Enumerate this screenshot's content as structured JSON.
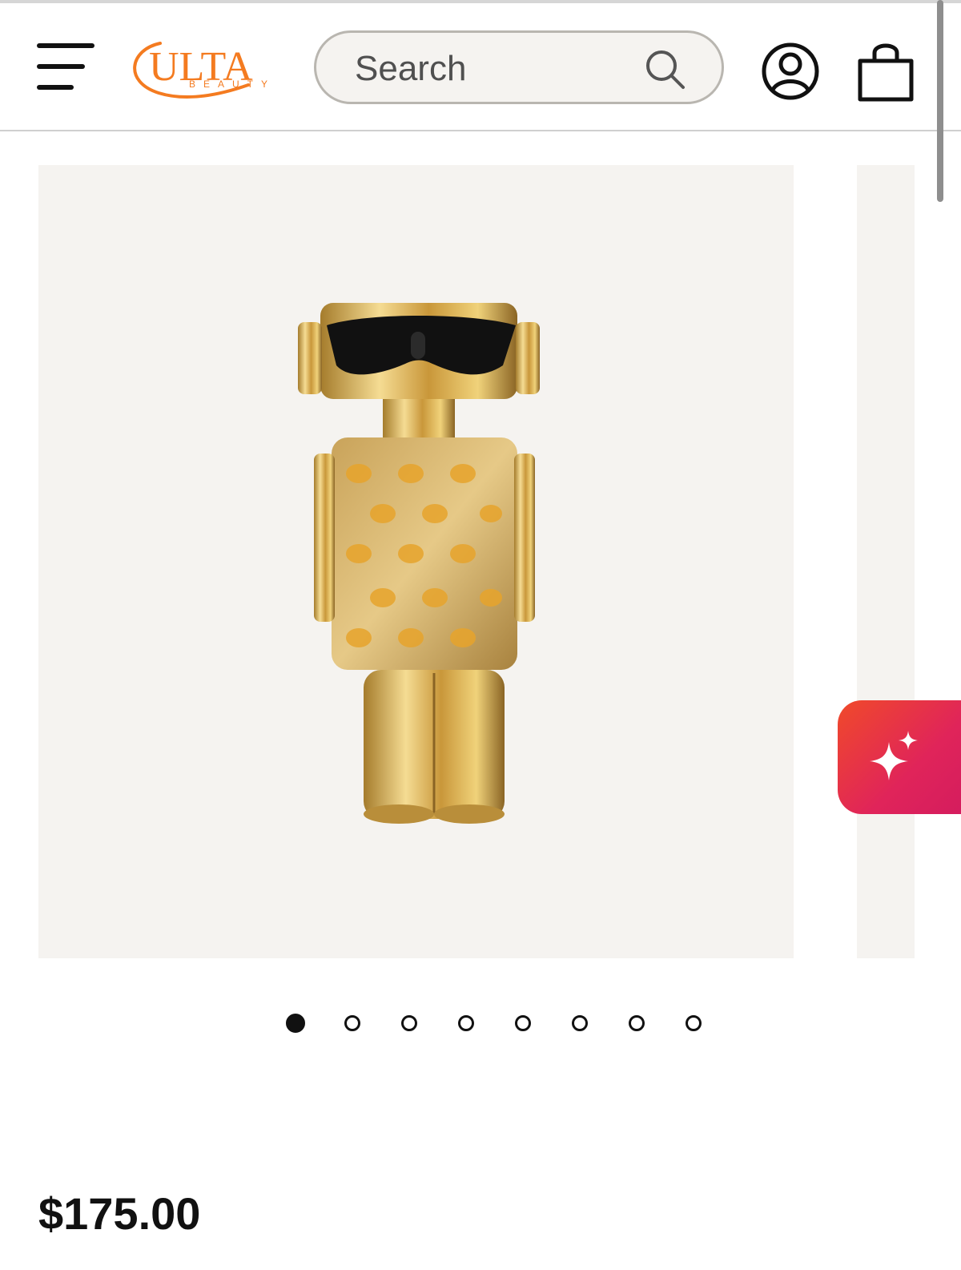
{
  "header": {
    "logo": {
      "brand": "ULTA",
      "subtitle": "BEAUTY",
      "color": "#f47b20"
    },
    "menu_icon": "hamburger-menu-icon",
    "search": {
      "placeholder": "Search",
      "value": "",
      "icon": "search-icon"
    },
    "account_icon": "account-icon",
    "bag_icon": "shopping-bag-icon"
  },
  "gallery": {
    "current_slide": 1,
    "slide_count": 8,
    "dots": [
      {
        "active": true
      },
      {
        "active": false
      },
      {
        "active": false
      },
      {
        "active": false
      },
      {
        "active": false
      },
      {
        "active": false
      },
      {
        "active": false
      },
      {
        "active": false
      }
    ],
    "image_background": "#f5f3f0"
  },
  "assistant_button": {
    "icon": "sparkle-icon",
    "gradient": [
      "#f04a2a",
      "#d41c5e"
    ]
  },
  "product": {
    "price": "$175.00"
  }
}
